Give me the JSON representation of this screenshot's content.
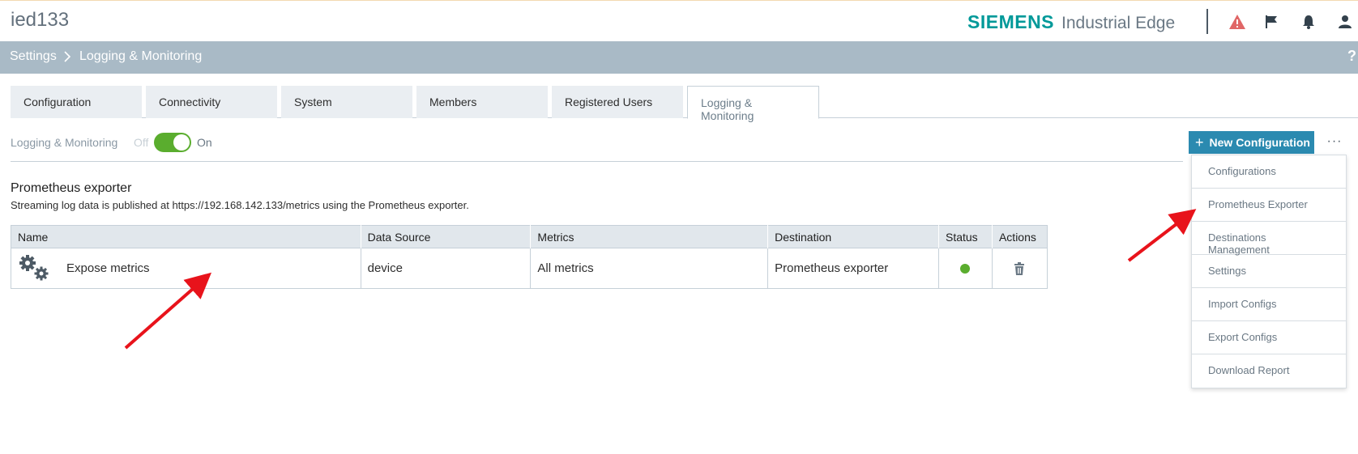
{
  "topbar": {
    "device_name": "ied133",
    "brand_siemens": "SIEMENS",
    "brand_product": "Industrial Edge",
    "icons": [
      "warning-icon",
      "flag-icon",
      "bell-icon",
      "user-icon"
    ]
  },
  "breadcrumb": {
    "items": [
      "Settings",
      "Logging & Monitoring"
    ],
    "separator": ">",
    "help": "?"
  },
  "tabs": [
    {
      "label": "Configuration",
      "active": false
    },
    {
      "label": "Connectivity",
      "active": false
    },
    {
      "label": "System",
      "active": false
    },
    {
      "label": "Members",
      "active": false
    },
    {
      "label": "Registered Users",
      "active": false
    },
    {
      "label": "Logging & Monitoring",
      "active": true
    }
  ],
  "toggle": {
    "label": "Logging & Monitoring",
    "off_label": "Off",
    "on_label": "On",
    "state": "on"
  },
  "actions": {
    "new_configuration": "New Configuration",
    "more": "···"
  },
  "section": {
    "title": "Prometheus exporter",
    "description": "Streaming log data is published at https://192.168.142.133/metrics using the Prometheus exporter."
  },
  "table": {
    "columns": [
      "Name",
      "Data Source",
      "Metrics",
      "Destination",
      "Status",
      "Actions"
    ],
    "rows": [
      {
        "name": "Expose metrics",
        "data_source": "device",
        "metrics": "All metrics",
        "destination": "Prometheus exporter",
        "status": "active"
      }
    ]
  },
  "dropdown": {
    "items": [
      "Configurations",
      "Prometheus Exporter",
      "Destinations Management",
      "Settings",
      "Import Configs",
      "Export Configs",
      "Download Report"
    ]
  },
  "colors": {
    "brand": "#009999",
    "primary_button": "#2b8ab0",
    "crumb_bar": "#a9bac6",
    "toggle_on": "#5aad2e",
    "status_ok": "#5aad2e",
    "warning": "#e06666",
    "annotation_arrow": "#e8131b"
  }
}
